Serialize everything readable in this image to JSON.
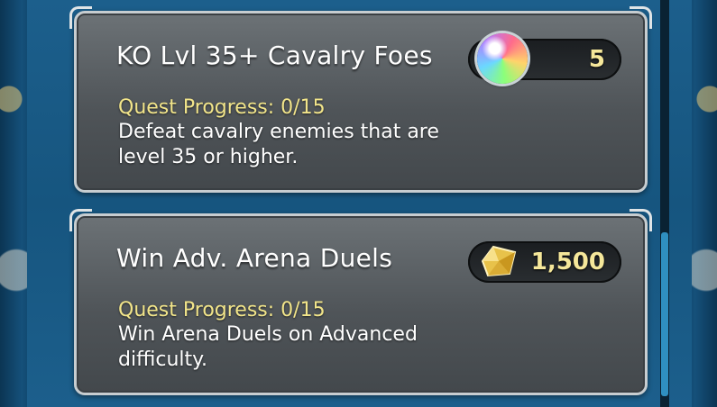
{
  "quests": [
    {
      "title": "KO Lvl 35+ Cavalry Foes",
      "progress": "Quest Progress: 0/15",
      "description": "Defeat cavalry enemies that are level 35 or higher.",
      "reward_icon": "orb-icon",
      "reward_amount": "5"
    },
    {
      "title": "Win Adv. Arena Duels",
      "progress": "Quest Progress: 0/15",
      "description": "Win Arena Duels on Advanced difficulty.",
      "reward_icon": "crystal-icon",
      "reward_amount": "1,500"
    }
  ],
  "colors": {
    "progress_text": "#f2e58a",
    "reward_text": "#f5e79a",
    "card_border": "#c7cdd0",
    "scroll_thumb": "#2f8fc0"
  }
}
